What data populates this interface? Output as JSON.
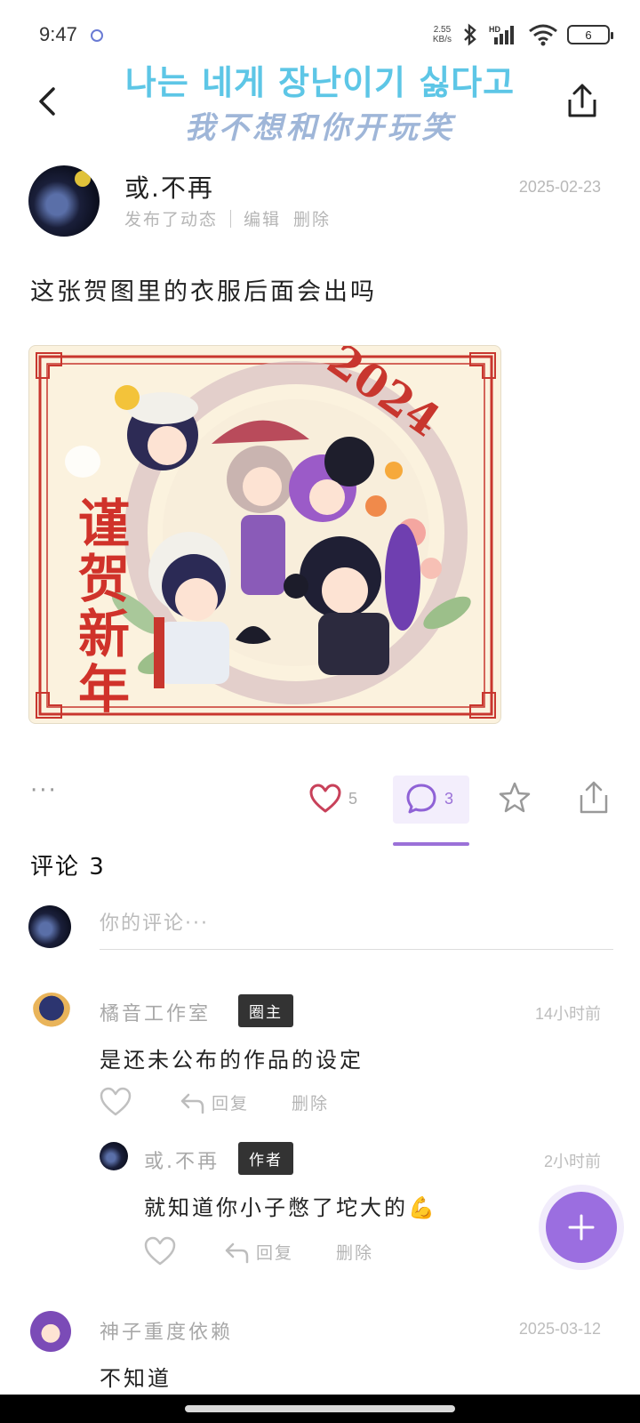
{
  "status_bar": {
    "time": "9:47",
    "net_speed_value": "2.55",
    "net_speed_unit": "KB/s",
    "battery": "6"
  },
  "header": {
    "banner_ko": "나는 네게 장난이기 싫다고",
    "banner_zh": "我不想和你开玩笑"
  },
  "post": {
    "author_name": "或.不再",
    "author_action": "发布了动态",
    "edit_label": "编辑",
    "delete_label": "删除",
    "date": "2025-02-23",
    "text": "这张贺图里的衣服后面会出吗",
    "image": {
      "year_text": "2024",
      "greeting": "谨贺新年"
    }
  },
  "actions": {
    "like_count": "5",
    "comment_count": "3",
    "more_label": "···"
  },
  "comments_section": {
    "title": "评论 3",
    "input_placeholder": "你的评论···"
  },
  "comments": [
    {
      "name": "橘音工作室",
      "badge": "圈主",
      "time": "14小时前",
      "text": "是还未公布的作品的设定",
      "reply_label": "回复",
      "delete_label": "删除",
      "replies": [
        {
          "name": "或.不再",
          "badge": "作者",
          "time": "2小时前",
          "text": "就知道你小子憋了坨大的💪",
          "reply_label": "回复",
          "delete_label": "删除"
        }
      ]
    },
    {
      "name": "神子重度依赖",
      "time": "2025-03-12",
      "text": "不知道"
    }
  ],
  "colors": {
    "accent": "#9b6ee0",
    "like": "#c8415a",
    "banner_ko": "#5dc6e6",
    "banner_zh": "#9fb6d8"
  },
  "icons": [
    "back-arrow-icon",
    "share-icon",
    "heart-icon",
    "comment-bubble-icon",
    "star-icon",
    "reply-arrow-icon",
    "plus-icon",
    "bluetooth-icon",
    "signal-icon",
    "wifi-icon",
    "battery-icon"
  ]
}
